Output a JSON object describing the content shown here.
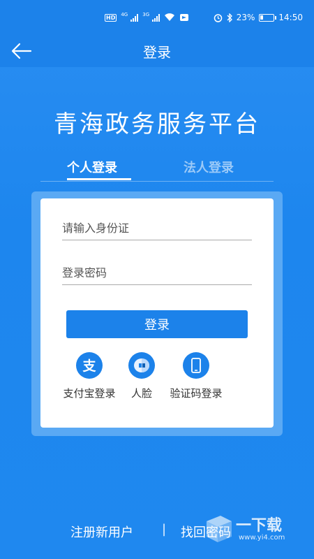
{
  "status_bar": {
    "network_badge": "HD",
    "net_1": "4G",
    "net_2": "3G",
    "battery_percent": "23%",
    "battery_level": 0.23,
    "time": "14:50"
  },
  "nav": {
    "title": "登录",
    "back_icon": "arrow-left-icon"
  },
  "platform_title": "青海政务服务平台",
  "tabs": [
    {
      "label": "个人登录",
      "active": true
    },
    {
      "label": "法人登录",
      "active": false
    }
  ],
  "form": {
    "id_placeholder": "请输入身份证",
    "id_value": "",
    "password_placeholder": "登录密码",
    "password_value": "",
    "login_button": "登录"
  },
  "alt_logins": [
    {
      "label": "支付宝登录",
      "icon": "alipay-icon"
    },
    {
      "label": "人脸",
      "icon": "face-icon"
    },
    {
      "label": "验证码登录",
      "icon": "phone-icon"
    }
  ],
  "bottom": {
    "register": "注册新用户",
    "separator": "|",
    "forgot_password": "找回密码"
  },
  "watermark": {
    "text": "一下载",
    "url": "www.yi4.com"
  },
  "colors": {
    "primary": "#1c82ea",
    "background": "#2a8ef2",
    "card": "#ffffff"
  }
}
